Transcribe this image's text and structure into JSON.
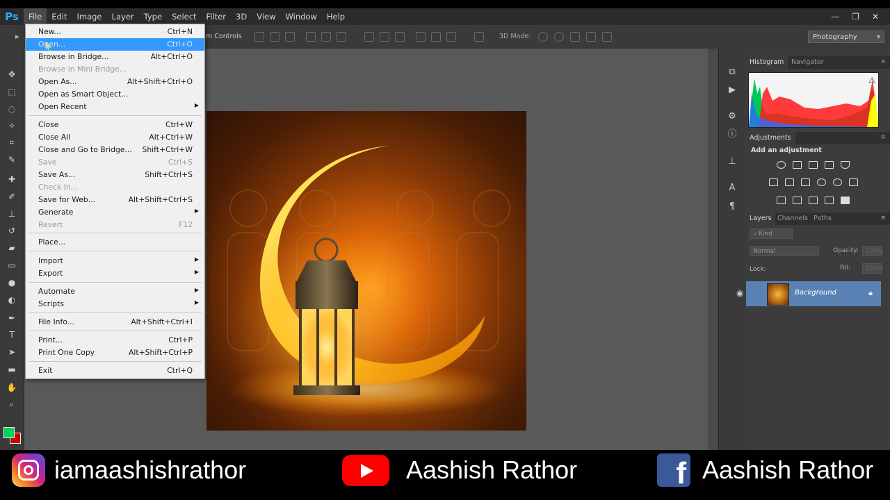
{
  "app": {
    "logo": "Ps"
  },
  "menubar": {
    "items": [
      "File",
      "Edit",
      "Image",
      "Layer",
      "Type",
      "Select",
      "Filter",
      "3D",
      "View",
      "Window",
      "Help"
    ]
  },
  "window_controls": [
    "—",
    "❐",
    "✕"
  ],
  "options_bar": {
    "partial_label": "m Controls",
    "mode_label": "3D Mode:",
    "workspace": "Photography"
  },
  "file_menu": {
    "new": {
      "label": "New...",
      "shortcut": "Ctrl+N"
    },
    "open": {
      "label": "Open...",
      "shortcut": "Ctrl+O"
    },
    "browse_bridge": {
      "label": "Browse in Bridge...",
      "shortcut": "Alt+Ctrl+O"
    },
    "browse_mini_bridge": {
      "label": "Browse in Mini Bridge..."
    },
    "open_as": {
      "label": "Open As...",
      "shortcut": "Alt+Shift+Ctrl+O"
    },
    "open_smart": {
      "label": "Open as Smart Object..."
    },
    "open_recent": {
      "label": "Open Recent"
    },
    "close": {
      "label": "Close",
      "shortcut": "Ctrl+W"
    },
    "close_all": {
      "label": "Close All",
      "shortcut": "Alt+Ctrl+W"
    },
    "close_bridge": {
      "label": "Close and Go to Bridge...",
      "shortcut": "Shift+Ctrl+W"
    },
    "save": {
      "label": "Save",
      "shortcut": "Ctrl+S"
    },
    "save_as": {
      "label": "Save As...",
      "shortcut": "Shift+Ctrl+S"
    },
    "check_in": {
      "label": "Check In..."
    },
    "save_web": {
      "label": "Save for Web...",
      "shortcut": "Alt+Shift+Ctrl+S"
    },
    "generate": {
      "label": "Generate"
    },
    "revert": {
      "label": "Revert",
      "shortcut": "F12"
    },
    "place": {
      "label": "Place..."
    },
    "import": {
      "label": "Import"
    },
    "export": {
      "label": "Export"
    },
    "automate": {
      "label": "Automate"
    },
    "scripts": {
      "label": "Scripts"
    },
    "file_info": {
      "label": "File Info...",
      "shortcut": "Alt+Shift+Ctrl+I"
    },
    "print": {
      "label": "Print...",
      "shortcut": "Ctrl+P"
    },
    "print_one": {
      "label": "Print One Copy",
      "shortcut": "Alt+Shift+Ctrl+P"
    },
    "exit": {
      "label": "Exit",
      "shortcut": "Ctrl+Q"
    }
  },
  "panels": {
    "histogram_tab": "Histogram",
    "navigator_tab": "Navigator",
    "adjustments_tab": "Adjustments",
    "add_adjustment": "Add an adjustment",
    "layers_tab": "Layers",
    "channels_tab": "Channels",
    "paths_tab": "Paths",
    "kind": "Kind",
    "blend_mode": "Normal",
    "opacity_label": "Opacity:",
    "opacity_value": "100%",
    "lock_label": "Lock:",
    "fill_label": "Fill:",
    "fill_value": "100%",
    "layer_name": "Background"
  },
  "banner": {
    "instagram": "iamaashishrathor",
    "youtube": "Aashish Rathor",
    "facebook": "Aashish Rathor"
  },
  "colors": {
    "menu_highlight": "#3399ff",
    "foreground": "#00d45a",
    "background": "#cc0000",
    "layer_selected": "#5a82b4"
  }
}
